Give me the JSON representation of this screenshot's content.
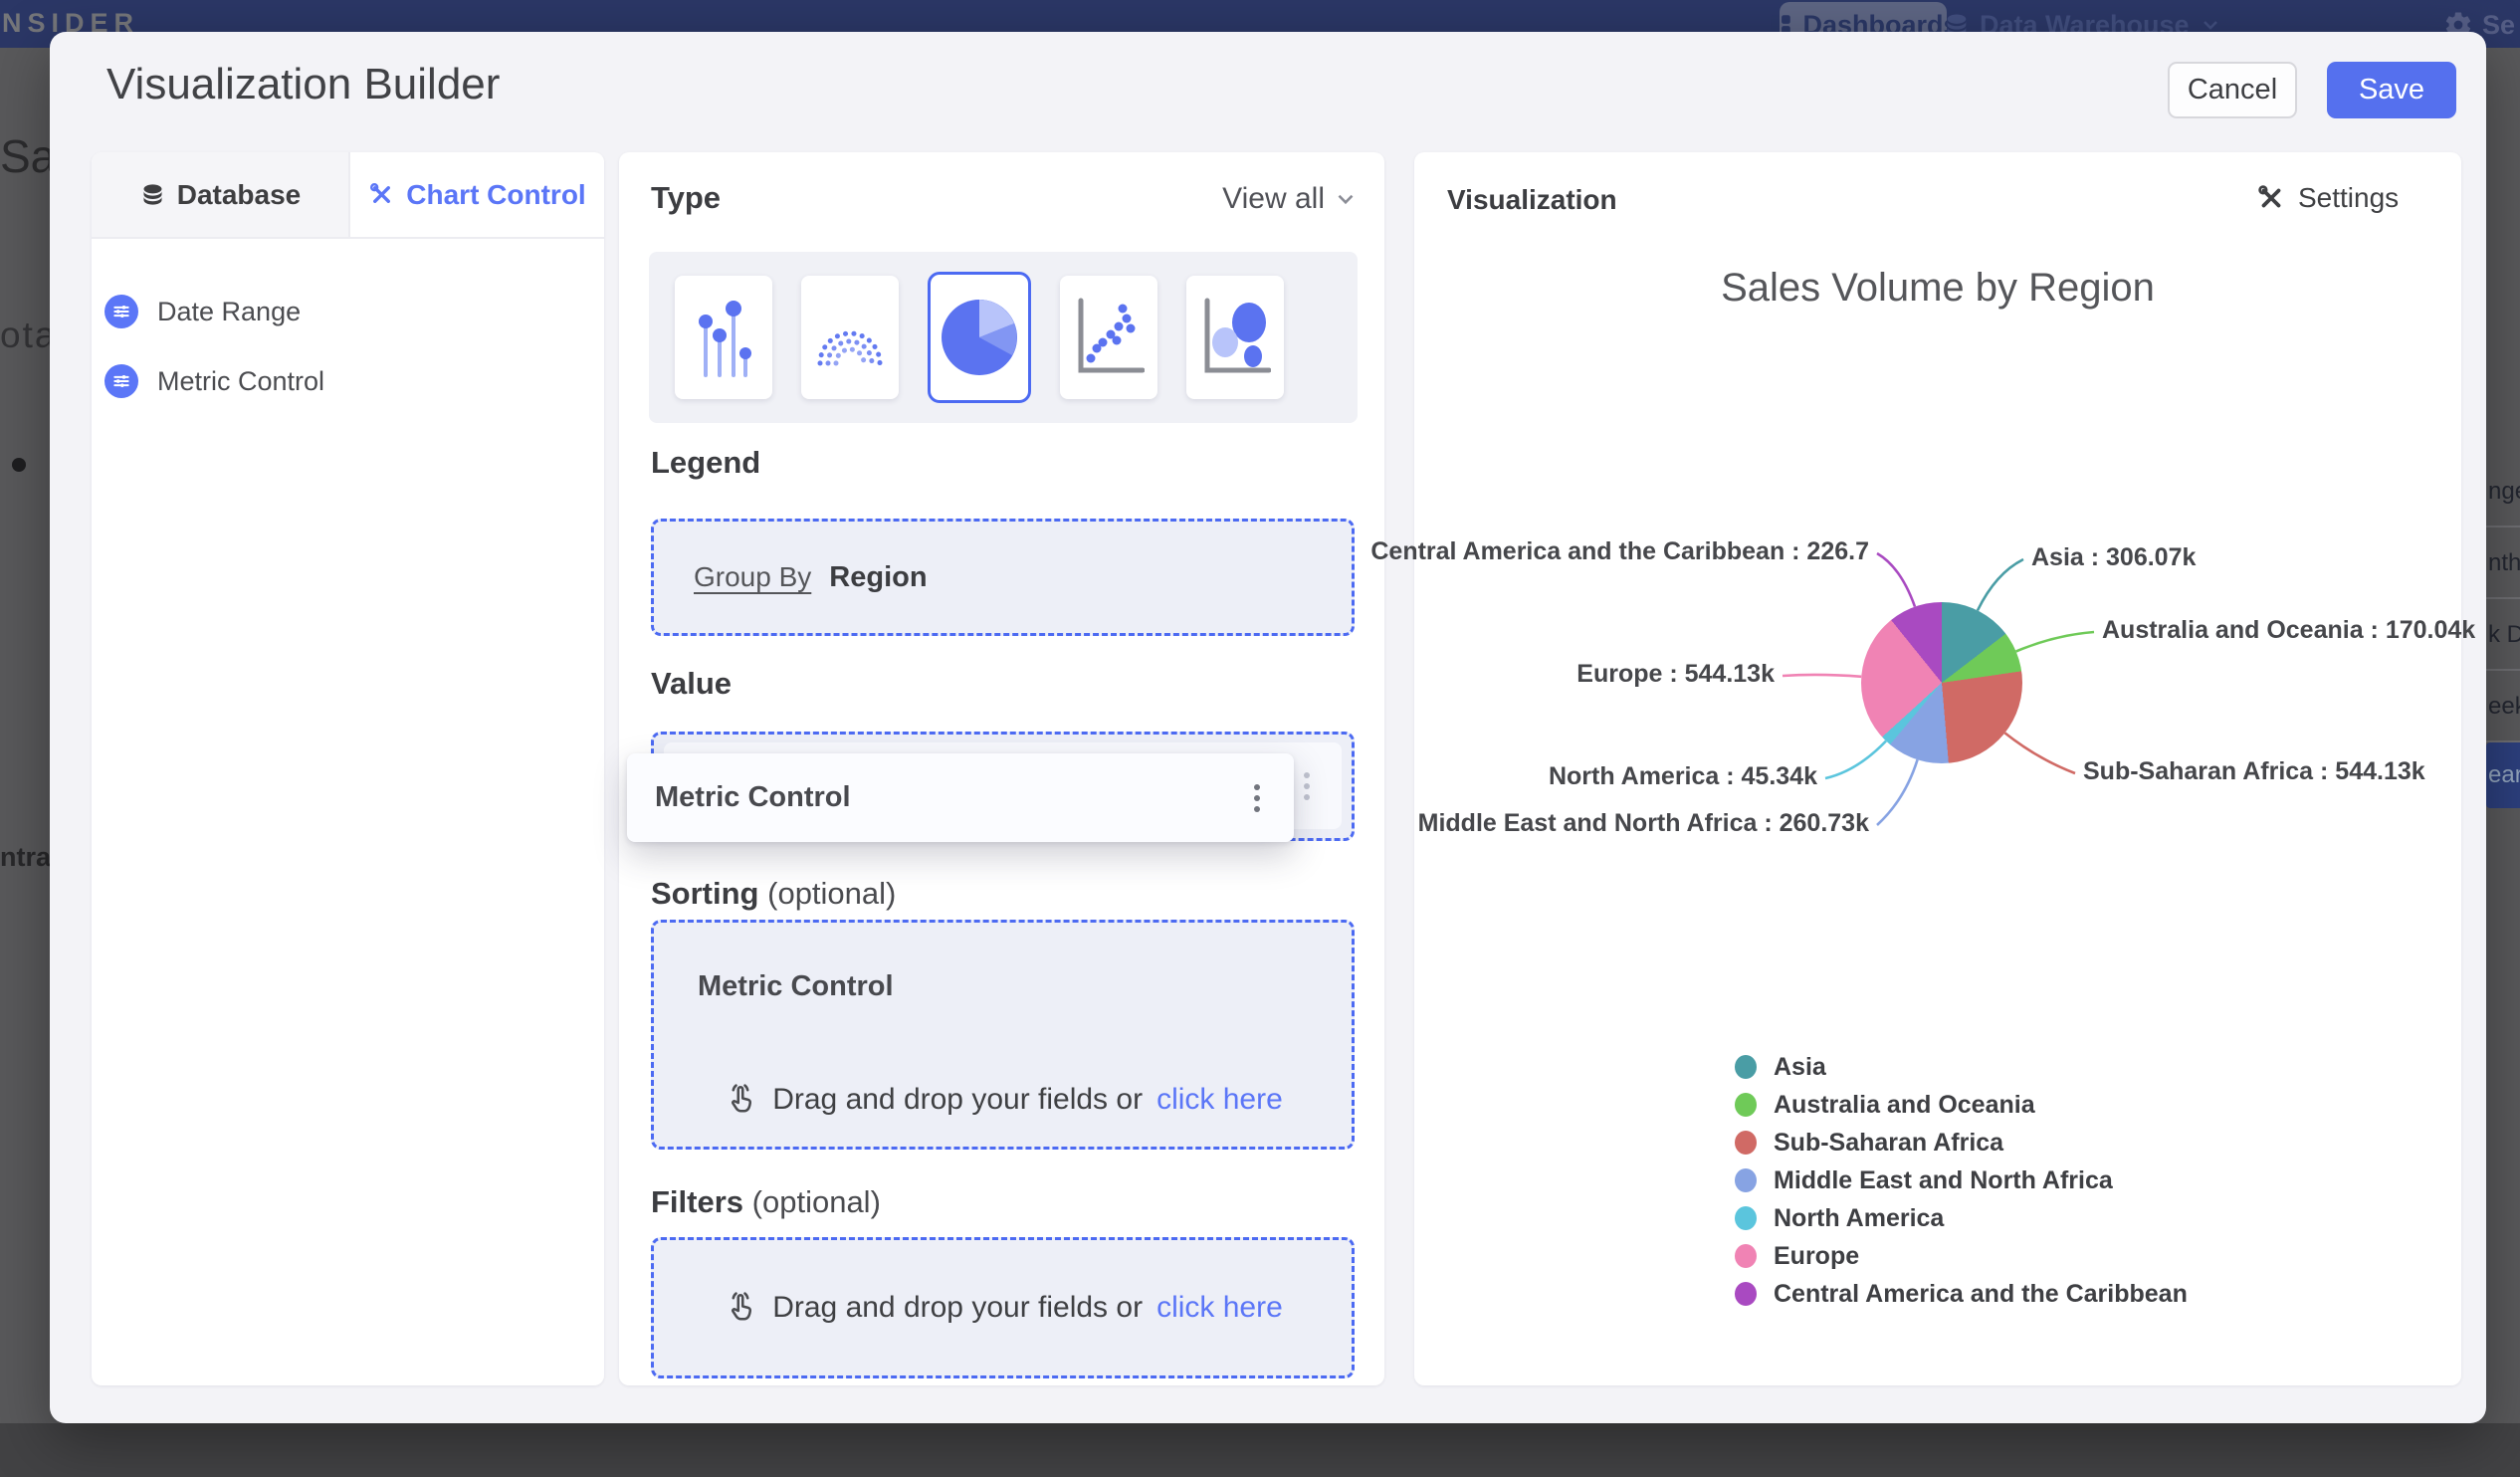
{
  "navbar": {
    "logo": "NSIDER",
    "dashboards_label": "Dashboards",
    "data_warehouse_label": "Data Warehouse",
    "settings_label": "Se"
  },
  "modal": {
    "title": "Visualization Builder",
    "cancel_label": "Cancel",
    "save_label": "Save"
  },
  "left_panel": {
    "tabs": [
      {
        "label": "Database"
      },
      {
        "label": "Chart Control"
      }
    ],
    "items": [
      {
        "label": "Date Range"
      },
      {
        "label": "Metric Control"
      }
    ]
  },
  "builder": {
    "type_label": "Type",
    "view_all_label": "View all",
    "chart_type_options": [
      "lollipop",
      "arc",
      "pie",
      "scatter",
      "bubble"
    ],
    "selected_chart_type": "pie",
    "legend_label": "Legend",
    "group_by_label": "Group By",
    "group_by_value": "Region",
    "value_label": "Value",
    "value_chip": "Metric Control",
    "value_chip_ghost": "Metric Control",
    "sorting_label": "Sorting",
    "sorting_optional": "(optional)",
    "sorting_chip": "Metric Control",
    "filters_label": "Filters",
    "filters_optional": "(optional)",
    "dropzone_text": "Drag and drop your fields or",
    "dropzone_link": "click here"
  },
  "visualization": {
    "panel_title": "Visualization",
    "settings_label": "Settings"
  },
  "background": {
    "left_fragments": {
      "heading": "Sal",
      "subheading": "ota",
      "footer": "ntral"
    },
    "right_fragments": [
      "nge",
      "nth",
      "k D",
      "eek",
      "ear"
    ]
  },
  "colors": {
    "accent": "#5570ee",
    "link": "#5b76f7",
    "dashed_border": "#4c6af2",
    "navbar": "#2b3766"
  },
  "chart_data": {
    "type": "pie",
    "title": "Sales Volume by Region",
    "legend_position": "bottom-left",
    "series": [
      {
        "name": "Asia",
        "value": 306.07,
        "label": "306.07k",
        "color": "#4a9da5"
      },
      {
        "name": "Australia and Oceania",
        "value": 170.04,
        "label": "170.04k",
        "color": "#6fca58"
      },
      {
        "name": "Sub-Saharan Africa",
        "value": 544.13,
        "label": "544.13k",
        "color": "#d06a65"
      },
      {
        "name": "Middle East and North Africa",
        "value": 260.73,
        "label": "260.73k",
        "color": "#87a3e3"
      },
      {
        "name": "North America",
        "value": 45.34,
        "label": "45.34k",
        "color": "#5bc5dd"
      },
      {
        "name": "Europe",
        "value": 544.13,
        "label": "544.13k",
        "color": "#f083b4"
      },
      {
        "name": "Central America and the Caribbean",
        "value": 226.7,
        "label": "226.7",
        "color": "#a94ac1"
      }
    ],
    "legend_order": [
      "Asia",
      "Australia and Oceania",
      "Sub-Saharan Africa",
      "Middle East and North Africa",
      "North America",
      "Europe",
      "Central America and the Caribbean"
    ]
  }
}
